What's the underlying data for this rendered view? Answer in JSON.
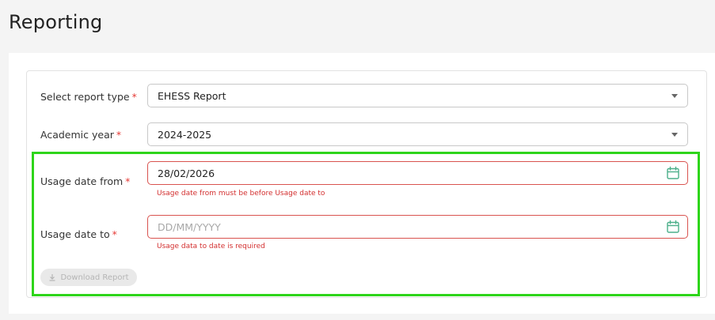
{
  "page": {
    "title": "Reporting"
  },
  "form": {
    "report_type": {
      "label": "Select report type",
      "required_mark": "*",
      "value": "EHESS Report"
    },
    "academic_year": {
      "label": "Academic year",
      "required_mark": "*",
      "value": "2024-2025"
    },
    "usage_date_from": {
      "label": "Usage date from",
      "required_mark": "*",
      "value": "28/02/2026",
      "error": "Usage date from must be before Usage date to"
    },
    "usage_date_to": {
      "label": "Usage date to",
      "required_mark": "*",
      "placeholder": "DD/MM/YYYY",
      "value": "",
      "error": "Usage data to date is required"
    },
    "download_button": {
      "label": "Download Report",
      "disabled": true
    }
  },
  "icons": {
    "report_type_caret": "chevron-down-icon",
    "academic_year_caret": "chevron-down-icon",
    "date_from_calendar": "calendar-icon",
    "date_to_calendar": "calendar-icon",
    "download": "download-icon"
  },
  "colors": {
    "error": "#d9534f",
    "required": "#e53935",
    "calendar_icon": "#4caf8a",
    "highlight_box": "#2ed51a"
  }
}
